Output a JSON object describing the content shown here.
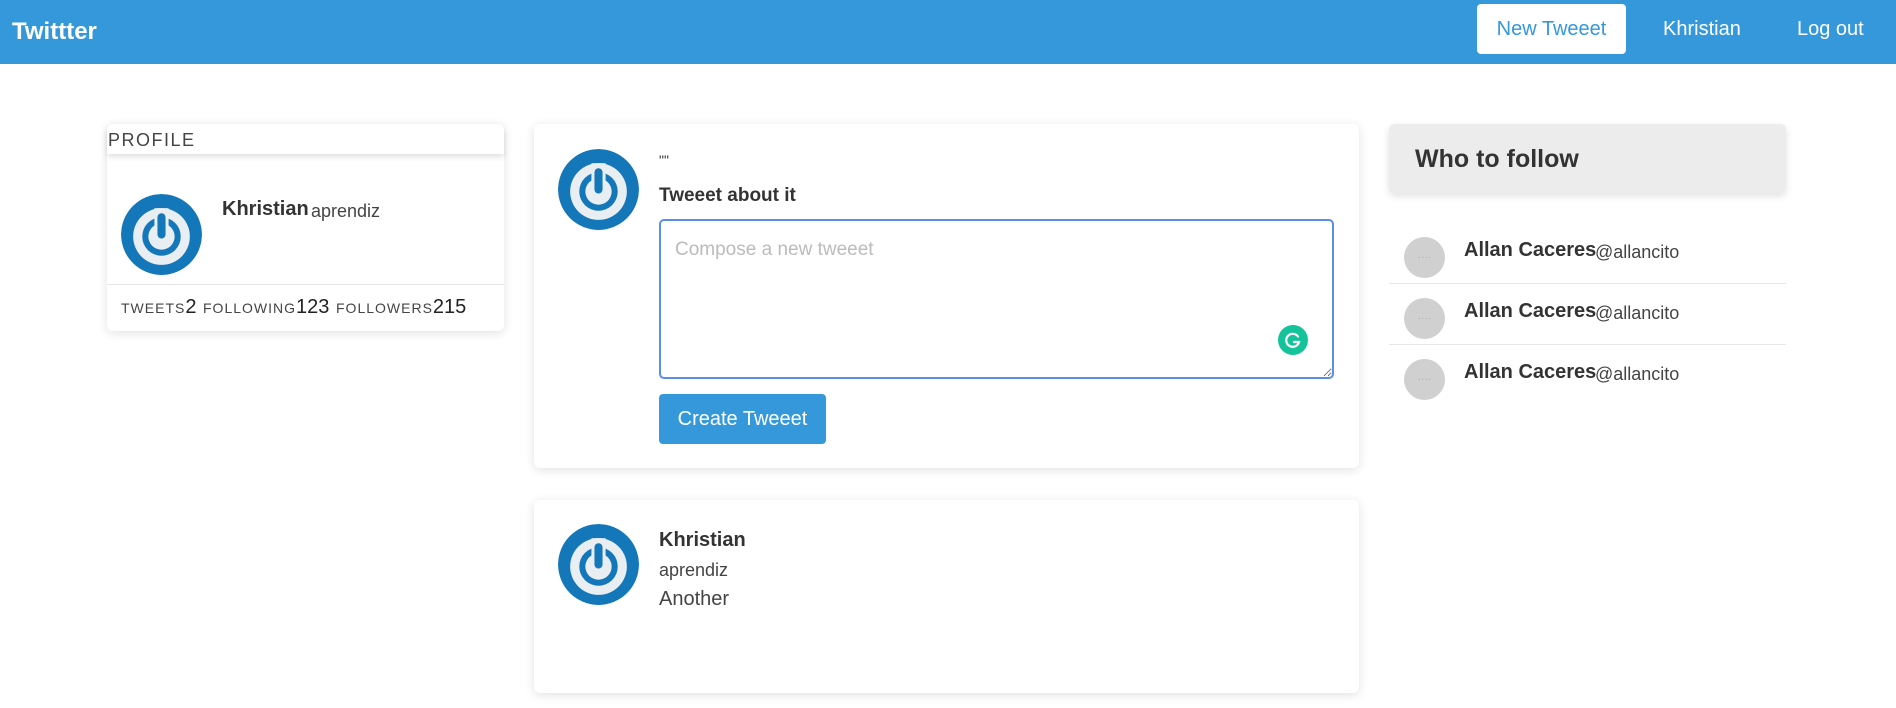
{
  "navbar": {
    "brand": "Twittter",
    "new_tweet_label": "New Tweeet",
    "user_label": "Khristian",
    "logout_label": "Log out",
    "accent_color": "#3498db"
  },
  "profile": {
    "title": "PROFILE",
    "name": "Khristian",
    "handle": "aprendiz",
    "stats": [
      {
        "label": "TWEETS",
        "value": "2"
      },
      {
        "label": "FOLLOWING",
        "value": "123"
      },
      {
        "label": "FOLLOWERS",
        "value": "215"
      }
    ]
  },
  "compose": {
    "quote_text": "\"\"",
    "label": "Tweeet about it",
    "placeholder": "Compose a new tweeet",
    "button_label": "Create Tweeet",
    "extension_icon": "grammarly-icon"
  },
  "tweets": [
    {
      "name": "Khristian",
      "handle": "aprendiz",
      "text": "Another"
    }
  ],
  "who_to_follow": {
    "title": "Who to follow",
    "users": [
      {
        "name": "Allan Caceres",
        "handle": "@allancito"
      },
      {
        "name": "Allan Caceres",
        "handle": "@allancito"
      },
      {
        "name": "Allan Caceres",
        "handle": "@allancito"
      }
    ]
  }
}
